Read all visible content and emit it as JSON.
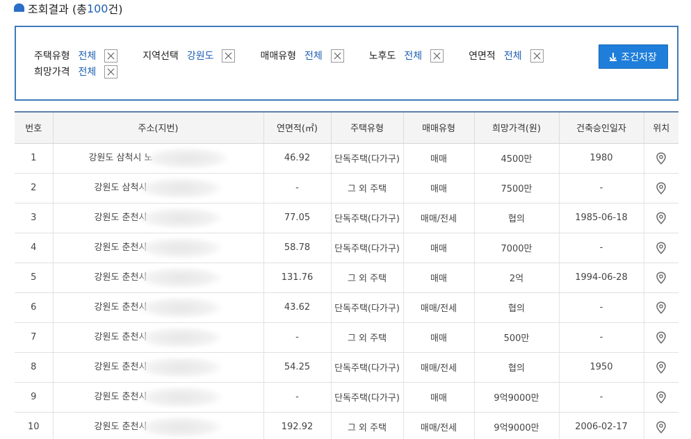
{
  "header": {
    "title": "조회결과 (총 ",
    "count": "100",
    "suffix": "건)"
  },
  "filters": [
    {
      "label": "주택유형",
      "value": "전체"
    },
    {
      "label": "지역선택",
      "value": "강원도"
    },
    {
      "label": "매매유형",
      "value": "전체"
    },
    {
      "label": "노후도",
      "value": "전체"
    },
    {
      "label": "연면적",
      "value": "전체"
    },
    {
      "label": "희망가격",
      "value": "전체"
    }
  ],
  "save_button": {
    "label": "조건저장",
    "icon": "download-icon"
  },
  "table": {
    "columns": [
      "번호",
      "주소(지번)",
      "연면적(㎡)",
      "주택유형",
      "매매유형",
      "희망가격(원)",
      "건축승인일자",
      "위치"
    ],
    "rows": [
      {
        "no": "1",
        "address": "강원도 삼척시 노",
        "area": "46.92",
        "type": "단독주택(다가구)",
        "trade": "매매",
        "price": "4500만",
        "date": "1980"
      },
      {
        "no": "2",
        "address": "강원도 삼척시",
        "area": "-",
        "type": "그 외 주택",
        "trade": "매매",
        "price": "7500만",
        "date": "-"
      },
      {
        "no": "3",
        "address": "강원도 춘천시",
        "area": "77.05",
        "type": "단독주택(다가구)",
        "trade": "매매/전세",
        "price": "협의",
        "date": "1985-06-18"
      },
      {
        "no": "4",
        "address": "강원도 춘천시",
        "area": "58.78",
        "type": "단독주택(다가구)",
        "trade": "매매",
        "price": "7000만",
        "date": "-"
      },
      {
        "no": "5",
        "address": "강원도 춘천시",
        "area": "131.76",
        "type": "그 외 주택",
        "trade": "매매",
        "price": "2억",
        "date": "1994-06-28"
      },
      {
        "no": "6",
        "address": "강원도 춘천시",
        "area": "43.62",
        "type": "단독주택(다가구)",
        "trade": "매매/전세",
        "price": "협의",
        "date": "-"
      },
      {
        "no": "7",
        "address": "강원도 춘천시",
        "area": "-",
        "type": "그 외 주택",
        "trade": "매매",
        "price": "500만",
        "date": "-"
      },
      {
        "no": "8",
        "address": "강원도 춘천시",
        "area": "54.25",
        "type": "단독주택(다가구)",
        "trade": "매매/전세",
        "price": "협의",
        "date": "1950"
      },
      {
        "no": "9",
        "address": "강원도 춘천시",
        "area": "-",
        "type": "단독주택(다가구)",
        "trade": "매매",
        "price": "9억9000만",
        "date": "-"
      },
      {
        "no": "10",
        "address": "강원도 춘천시",
        "area": "192.92",
        "type": "그 외 주택",
        "trade": "매매/전세",
        "price": "9억9000만",
        "date": "2006-02-17"
      }
    ],
    "location_icon": "map-pin-icon"
  },
  "colors": {
    "accent": "#1f7ed9",
    "link": "#1d5fb3",
    "border": "#3d7ab8"
  }
}
